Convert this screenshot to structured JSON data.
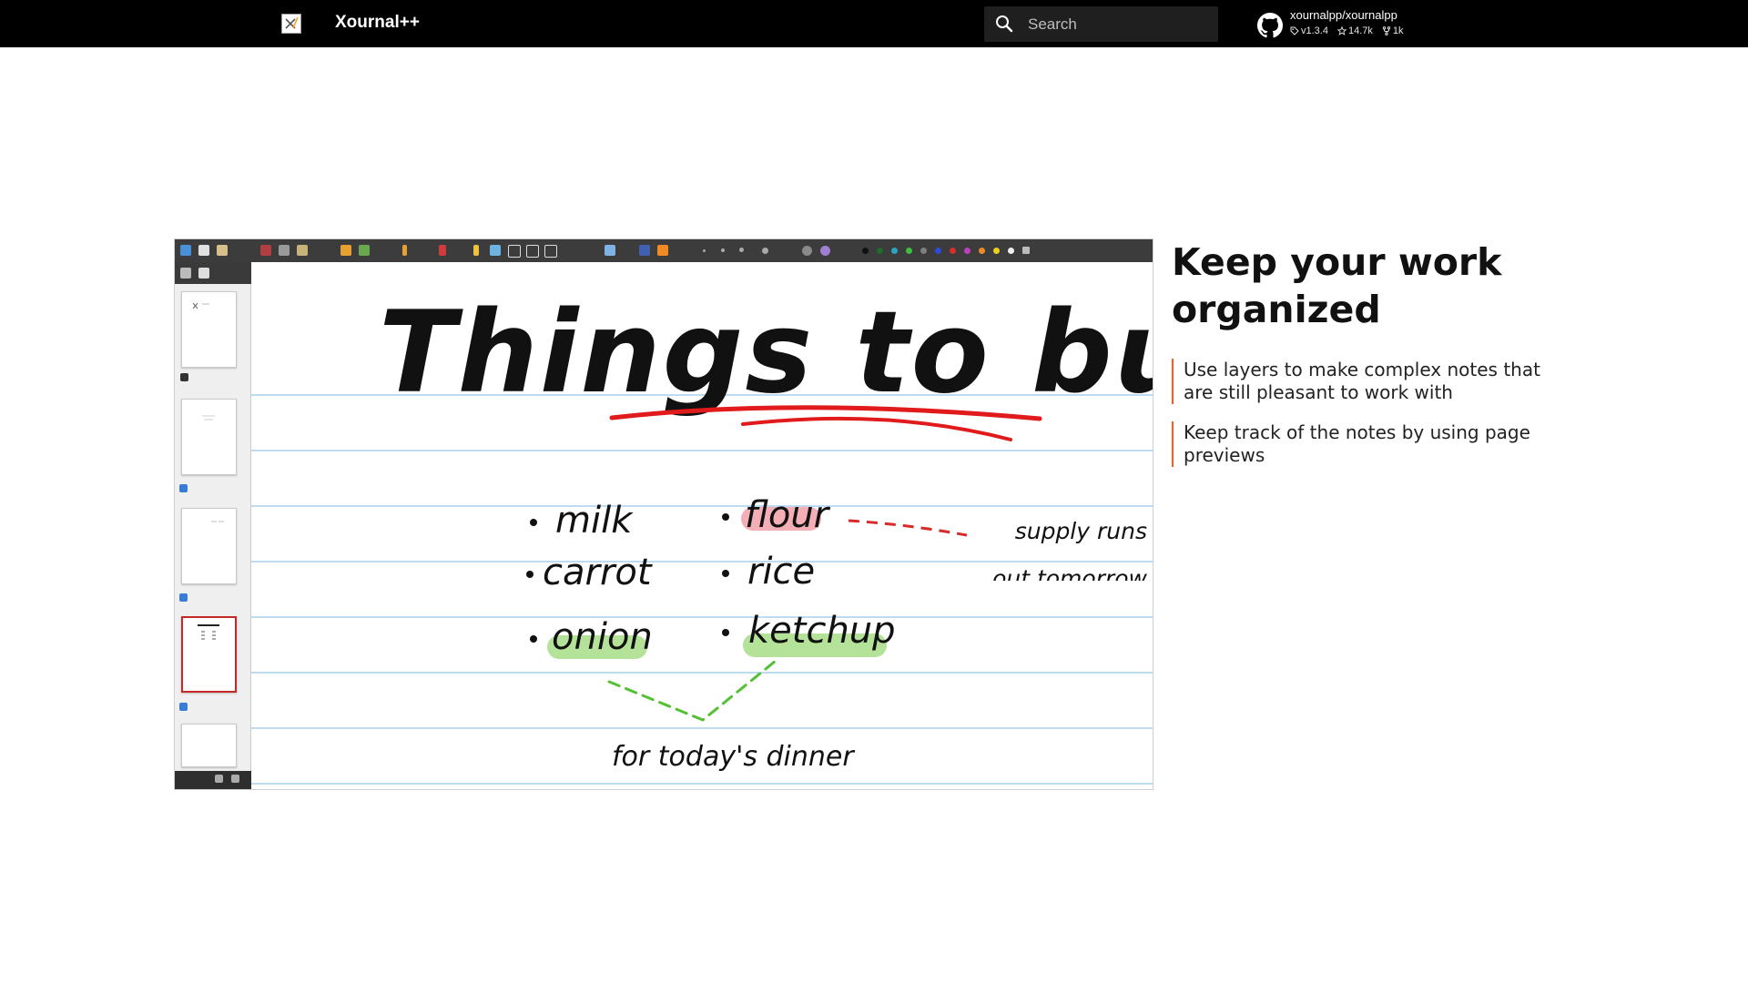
{
  "header": {
    "site_title": "Xournal++",
    "search_placeholder": "Search",
    "repo": {
      "name": "xournalpp/xournalpp",
      "version": "v1.3.4",
      "stars": "14.7k",
      "forks": "1k"
    }
  },
  "feature": {
    "heading": "Keep your work organized",
    "bullets": [
      "Use layers to make complex notes that are still pleasant to work with",
      "Keep track of the notes by using page previews"
    ],
    "accent_color": "#ff5722"
  },
  "notes_page": {
    "title": "Things to buy",
    "items": [
      "milk",
      "carrot",
      "onion",
      "flour",
      "rice",
      "ketchup"
    ],
    "aside": "supply runs out tomorrow",
    "footer": "for today's dinner"
  },
  "icons": {
    "logo": "xournal-logo-icon",
    "search": "search-icon",
    "github": "github-icon",
    "tag": "tag-icon",
    "star": "star-icon",
    "fork": "fork-icon"
  }
}
